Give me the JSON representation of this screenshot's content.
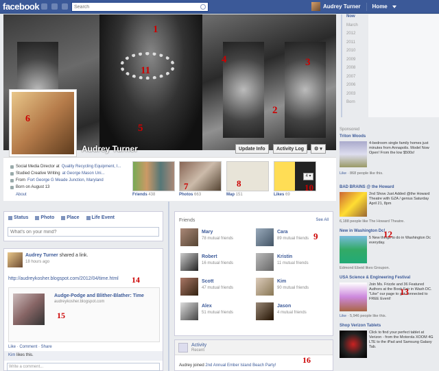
{
  "topbar": {
    "logo": "facebook",
    "search_placeholder": "Search",
    "user_name": "Audrey Turner",
    "home_label": "Home"
  },
  "cover": {
    "markers": [
      "1",
      "2",
      "3",
      "4",
      "5",
      "11"
    ]
  },
  "profile": {
    "name": "Audrey Turner",
    "update_info": "Update Info",
    "activity_log": "Activity Log",
    "gear": "⚙ ▾",
    "pic_marker": "6"
  },
  "info": {
    "rows": [
      {
        "prefix": "Social Media Director at ",
        "link": "Quality Recycling Equipment, I..."
      },
      {
        "prefix": "Studied Creative Writing ",
        "link": "at George Mason Uni..."
      },
      {
        "prefix": "From ",
        "link": "Fort George G Meade Junction, Maryland"
      },
      {
        "prefix": "Born on August 13",
        "link": ""
      }
    ],
    "about": "About"
  },
  "tiles": [
    {
      "label": "Friends",
      "count": "438",
      "marker": ""
    },
    {
      "label": "Photos",
      "count": "663",
      "marker": "7"
    },
    {
      "label": "Map",
      "count": "151",
      "marker": "8"
    },
    {
      "label": "Likes",
      "count": "69",
      "marker": "10"
    }
  ],
  "tiles_more": "4 ▾",
  "composer": {
    "tabs": [
      "Status",
      "Photo",
      "Place",
      "Life Event"
    ],
    "placeholder": "What's on your mind?"
  },
  "post": {
    "author": "Audrey Turner",
    "action": " shared a link.",
    "time": "18 hours ago",
    "url": "http://audreykosher.blogspot.com/2012/04/time.html",
    "url_marker": "14",
    "card_title": "Audge-Podge and Blither-Blather: Time",
    "card_domain": "audreykosher.blogspot.com",
    "card_marker": "15",
    "actions": "Like · Comment · Share",
    "likes_name": "Kim",
    "likes_suffix": " likes this.",
    "comment_placeholder": "Write a comment..."
  },
  "friends": {
    "header": "Friends",
    "see_all": "See All",
    "marker": "9",
    "items": [
      {
        "name": "Mary",
        "mutual": "78 mutual friends"
      },
      {
        "name": "Cara",
        "mutual": "89 mutual friends"
      },
      {
        "name": "Robert",
        "mutual": "16 mutual friends"
      },
      {
        "name": "Kristin",
        "mutual": "11 mutual friends"
      },
      {
        "name": "Scott",
        "mutual": "47 mutual friends"
      },
      {
        "name": "Kim",
        "mutual": "90 mutual friends"
      },
      {
        "name": "Alex",
        "mutual": "51 mutual friends"
      },
      {
        "name": "Jason",
        "mutual": "4 mutual friends"
      }
    ]
  },
  "activity": {
    "title": "Activity",
    "subtitle": "Recent",
    "marker": "16",
    "row_prefix": "Audrey joined ",
    "row_link": "2nd Annual Ember Island Beach Party!"
  },
  "years": [
    "Now",
    "March",
    "2012",
    "2011",
    "2010",
    "2009",
    "2008",
    "2007",
    "2006",
    "2003",
    "Born"
  ],
  "sponsored": {
    "header": "Sponsored",
    "ads": [
      {
        "title": "Triton Woods",
        "text": "4-bedroom single family homes just minutes from Annapolis. Model Now Open! From the low $500s!",
        "foot_link": "Like",
        "foot": " · 868 people like this.",
        "marker": ""
      },
      {
        "title": "BAD BRAINS @ the Howard",
        "text": "2nd Show Just Added @the Howard Theatre with GZA / genius Saturday April 21, 8pm",
        "foot_link": "",
        "foot": "6,188 people like The Howard Theatre.",
        "marker": ""
      },
      {
        "title": "New in Washington Dc!",
        "text": "5 New things to do in Washington Dc everyday.",
        "foot_link": "",
        "foot": "Edmond Ebeid likes Groupon.",
        "marker": "12"
      },
      {
        "title": "USA Science & Engineering Festival",
        "text": "Join Ms. Frizzle and 36 Featured Authors at the Book Fair in Wash DC. \"Like\" our page to get connected to FREE Event!",
        "foot_link": "Like",
        "foot": " · 5,946 people like this.",
        "marker": "13"
      },
      {
        "title": "Shop Verizon Tablets",
        "text": "Click to find your perfect tablet at Verizon - from the Motorola XOOM 4G LTE to the iPad and Samsung Galaxy Tab.",
        "foot_link": "",
        "foot": "",
        "marker": ""
      }
    ]
  }
}
